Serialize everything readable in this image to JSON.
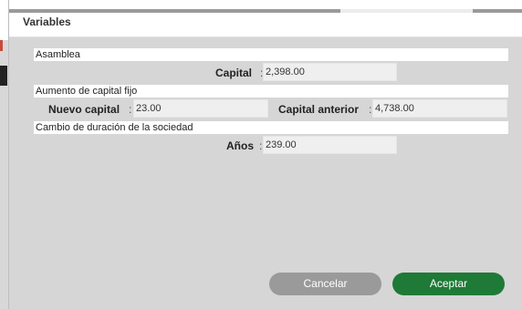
{
  "dialog": {
    "title": "Variables"
  },
  "sections": {
    "asamblea": "Asamblea",
    "aumento": "Aumento de capital fijo",
    "cambio": "Cambio de duración de la sociedad"
  },
  "fields": {
    "capital": {
      "label": "Capital",
      "value": "2,398.00"
    },
    "nuevo_capital": {
      "label": "Nuevo capital",
      "value": "23.00"
    },
    "capital_anterior": {
      "label": "Capital anterior",
      "value": "4,738.00"
    },
    "anos": {
      "label": "Años",
      "value": "239.00"
    }
  },
  "colon": ":",
  "buttons": {
    "cancel": "Cancelar",
    "accept": "Aceptar"
  },
  "colors": {
    "accept": "#1e7a36",
    "cancel": "#9a9a9a",
    "panel": "#d6d6d6"
  }
}
